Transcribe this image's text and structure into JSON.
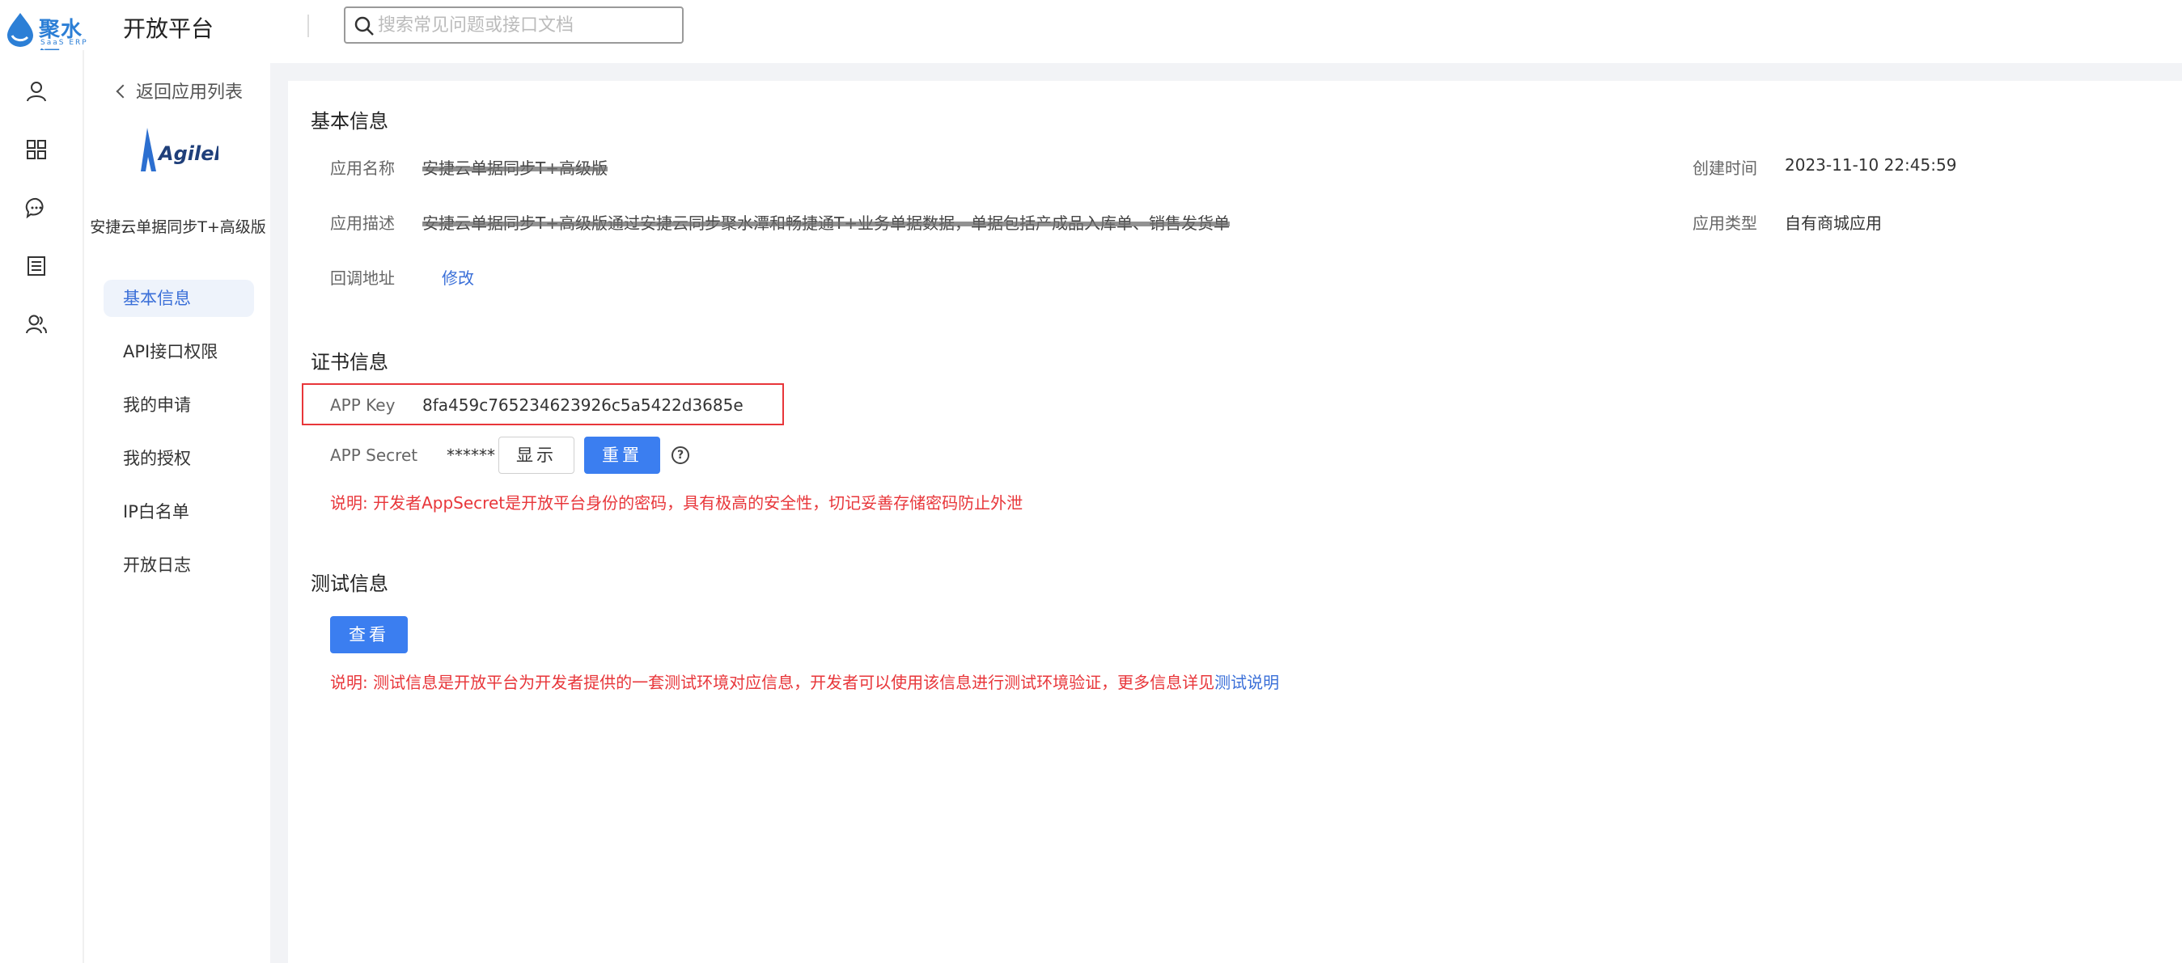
{
  "header": {
    "brand": "聚水潭",
    "brand_sub": "SaaS ERP",
    "title": "开放平台",
    "search_placeholder": "搜索常见问题或接口文档"
  },
  "rail": {
    "icons": [
      "user-icon",
      "grid-apps-icon",
      "chat-bubble-icon",
      "list-document-icon",
      "team-users-icon"
    ]
  },
  "submenu": {
    "back_label": "返回应用列表",
    "app_logo_text": "AgileFlow",
    "app_name": "安捷云单据同步T+高级版",
    "items": [
      {
        "label": "基本信息",
        "active": true
      },
      {
        "label": "API接口权限",
        "active": false
      },
      {
        "label": "我的申请",
        "active": false
      },
      {
        "label": "我的授权",
        "active": false
      },
      {
        "label": "IP白名单",
        "active": false
      },
      {
        "label": "开放日志",
        "active": false
      }
    ]
  },
  "basic": {
    "title": "基本信息",
    "app_name_label": "应用名称",
    "app_name_value": "安捷云单据同步T+高级版",
    "desc_label": "应用描述",
    "desc_value": "安捷云单据同步T+高级版通过安捷云同步聚水潭和畅捷通T+业务单据数据，单据包括产成品入库单、销售发货单",
    "callback_label": "回调地址",
    "callback_action": "修改",
    "created_label": "创建时间",
    "created_value": "2023-11-10 22:45:59",
    "type_label": "应用类型",
    "type_value": "自有商城应用"
  },
  "cert": {
    "title": "证书信息",
    "app_key_label": "APP Key",
    "app_key_value": "8fa459c765234623926c5a5422d3685e",
    "app_secret_label": "APP Secret",
    "app_secret_value": "******",
    "show_button": "显示",
    "reset_button": "重置",
    "help_glyph": "?",
    "note": "说明: 开发者AppSecret是开放平台身份的密码，具有极高的安全性，切记妥善存储密码防止外泄"
  },
  "test": {
    "title": "测试信息",
    "view_button": "查看",
    "note": "说明: 测试信息是开放平台为开发者提供的一套测试环境对应信息，开发者可以使用该信息进行测试环境验证，更多信息详见",
    "note_link": "测试说明"
  },
  "colors": {
    "primary": "#3b7ef0",
    "link": "#3a6fd8",
    "warning_red": "#e8363a",
    "brand_blue": "#2c7fd6"
  }
}
